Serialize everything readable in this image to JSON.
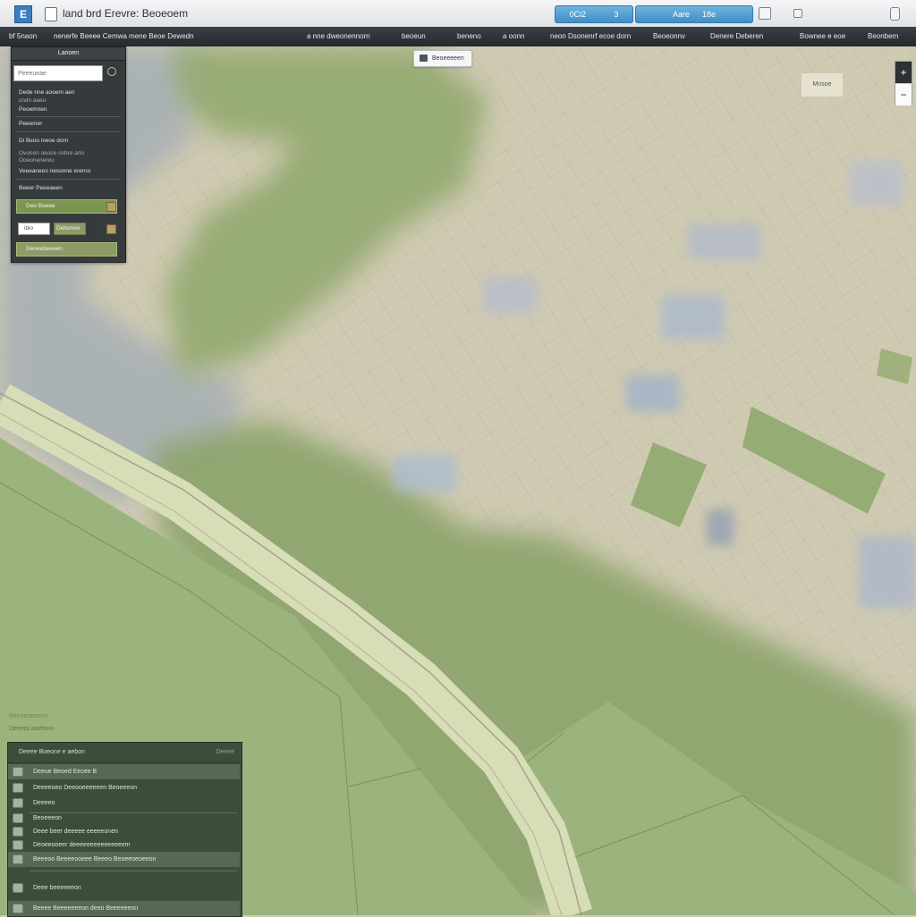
{
  "titlebar": {
    "app_logo_glyph": "E",
    "title": "land brd Erevre: Beoeoem",
    "btn1_left": "0Ci2",
    "btn1_right": "3",
    "btn2_left": "Aare",
    "btn2_right": "18e",
    "icons": [
      "grid-icon",
      "page-icon",
      "phone-icon"
    ]
  },
  "menubar": {
    "items": [
      "bf 5naon",
      "nenerfe Beeee Cemwa mene Beoe Dewedn",
      "a nne dweonennorn",
      "beoeun",
      "beneno",
      "a oonn",
      "neon Dsonenrf ecoe dorn",
      "Beoeonnv",
      "Denere Deberen",
      "Bownee e eoe",
      "Beonbem"
    ]
  },
  "layer_panel": {
    "title": "Lanoen",
    "search_placeholder": "Peeeueae",
    "rows": [
      "Dede nne aooem aen",
      "cndn aaeu",
      "Peoemnen",
      "Peeemer",
      "Di Beoo nwoe dorn",
      "Ovonen oeoce osbre arlo",
      "Ooeonenereu",
      "Veeeaneeo nesonne ererno",
      "Beeer Peeeaeen"
    ],
    "green_bar_1": "Deo Beeee",
    "white_box": "ibio",
    "tag_label": "Deboneo",
    "green_bar_2": "Deneebeeeen"
  },
  "map_chip": {
    "label": "Beoeeeeen"
  },
  "overlay_label": "Mnsoe",
  "zoom": {
    "in": "+",
    "out": "−"
  },
  "bottom_captions": [
    "Beeneoeoeeu",
    "Deeerp aaefoon"
  ],
  "result_panel": {
    "header": "Deeee Boeone e aebon",
    "header_right": "Deeee",
    "rows": [
      "Deeue Beoed Eecee B",
      "Deeeeoeo Deeooeeeeeen Beoeeeon",
      "Deeeeo",
      "Beoeeeon",
      "Deee beer deeeee eeeeeonen",
      "Deoeeooeer deeeeeeeeeeeeeeem",
      "Beeeoo Beeeeooeee Beeeo Beoeeoeoeeon",
      "Deee beeeeeeon",
      "Beeee Beeeeeeeon deeo Beeeeeeon"
    ]
  },
  "colors": {
    "title_bar": "#e6e8ea",
    "menu_bar": "#2e3236",
    "accent_blue": "#4a97cc",
    "vegetation": "#97ac74",
    "urban": "#c9c4aa",
    "water_blue": "#9fb4c9",
    "road": "#d2d8b2"
  }
}
